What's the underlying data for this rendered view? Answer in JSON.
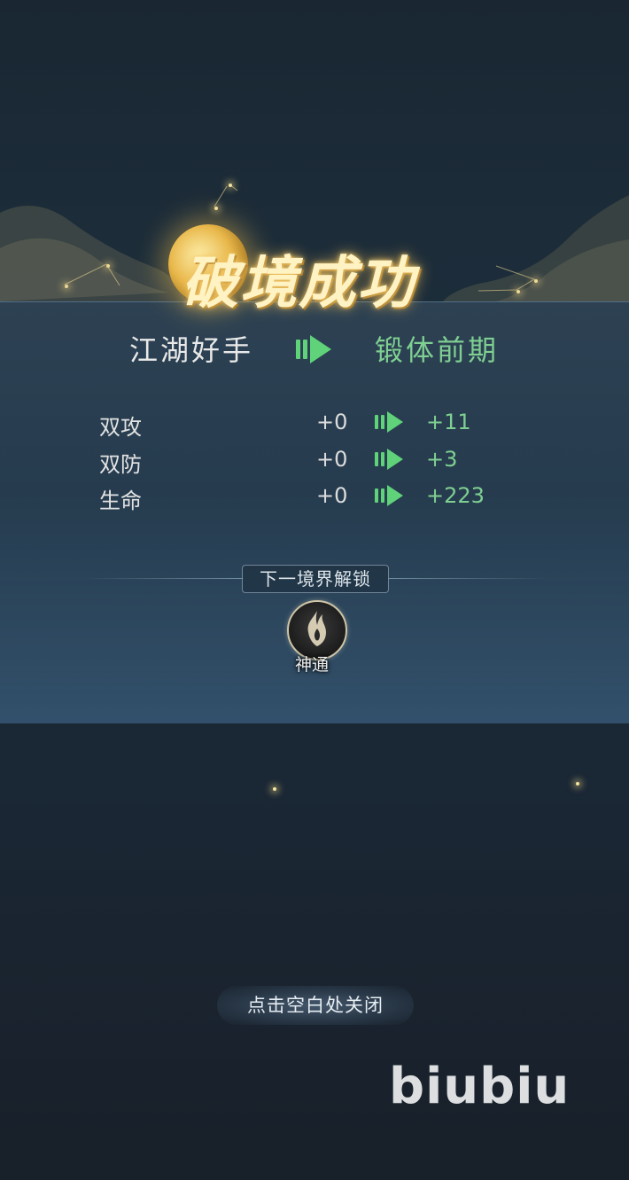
{
  "title": "破境成功",
  "realm": {
    "from": "江湖好手",
    "to": "锻体前期"
  },
  "stats": [
    {
      "label": "双攻",
      "old": "+0",
      "new": "+11"
    },
    {
      "label": "双防",
      "old": "+0",
      "new": "+3"
    },
    {
      "label": "生命",
      "old": "+0",
      "new": "+223"
    }
  ],
  "unlock": {
    "header": "下一境界解锁",
    "skill_label": "神通"
  },
  "close_hint": "点击空白处关闭",
  "watermark": "biubiu",
  "colors": {
    "accent_green": "#5fd27a",
    "new_value_green": "#7fcf92",
    "title_gold": "#fff3c4"
  }
}
